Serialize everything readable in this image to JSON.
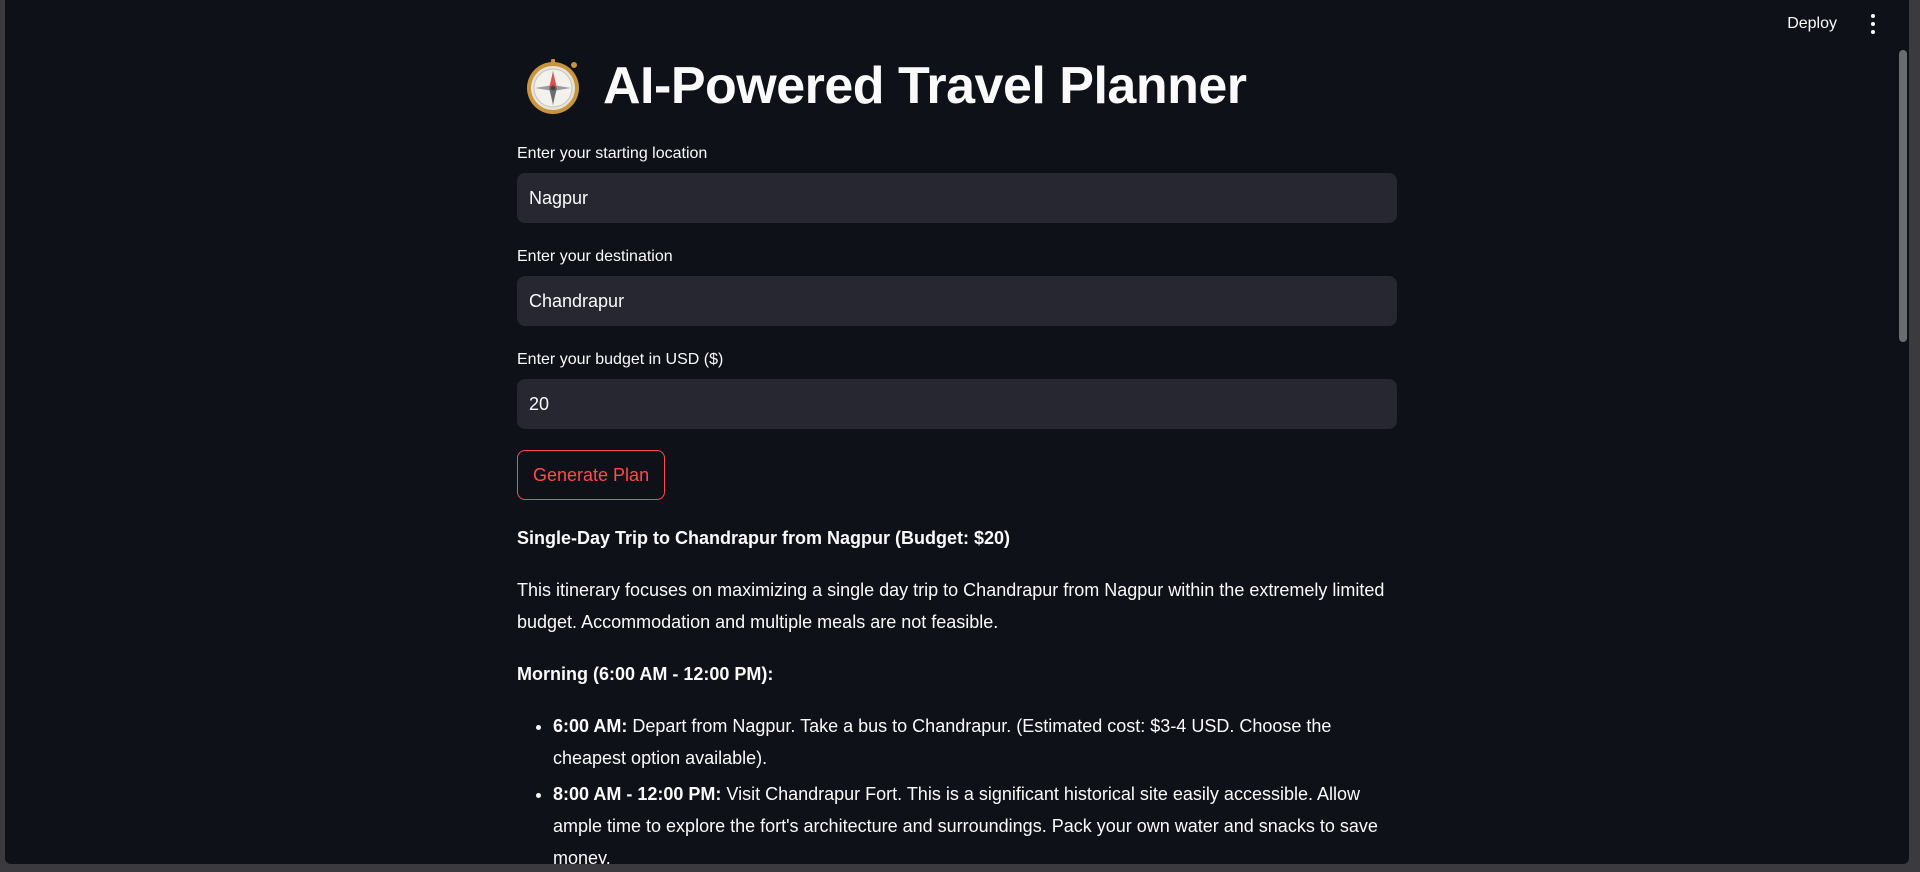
{
  "header": {
    "deploy_label": "Deploy"
  },
  "page": {
    "title": "AI-Powered Travel Planner"
  },
  "form": {
    "start_label": "Enter your starting location",
    "start_value": "Nagpur",
    "dest_label": "Enter your destination",
    "dest_value": "Chandrapur",
    "budget_label": "Enter your budget in USD ($)",
    "budget_value": "20",
    "generate_label": "Generate Plan"
  },
  "plan": {
    "heading": "Single-Day Trip to Chandrapur from Nagpur (Budget: $20)",
    "intro": "This itinerary focuses on maximizing a single day trip to Chandrapur from Nagpur within the extremely limited budget. Accommodation and multiple meals are not feasible.",
    "morning_heading": "Morning (6:00 AM - 12:00 PM):",
    "items": [
      {
        "time": "6:00 AM:",
        "text": " Depart from Nagpur. Take a bus to Chandrapur. (Estimated cost: $3-4 USD. Choose the cheapest option available)."
      },
      {
        "time": "8:00 AM - 12:00 PM:",
        "text": " Visit Chandrapur Fort. This is a significant historical site easily accessible. Allow ample time to explore the fort's architecture and surroundings. Pack your own water and snacks to save money."
      }
    ]
  },
  "colors": {
    "background": "#0e1117",
    "input_bg": "#262730",
    "text": "#fafafa",
    "accent": "#ff4b4b"
  },
  "icons": {
    "title_icon": "compass-icon",
    "menu_icon": "kebab-menu-icon"
  }
}
